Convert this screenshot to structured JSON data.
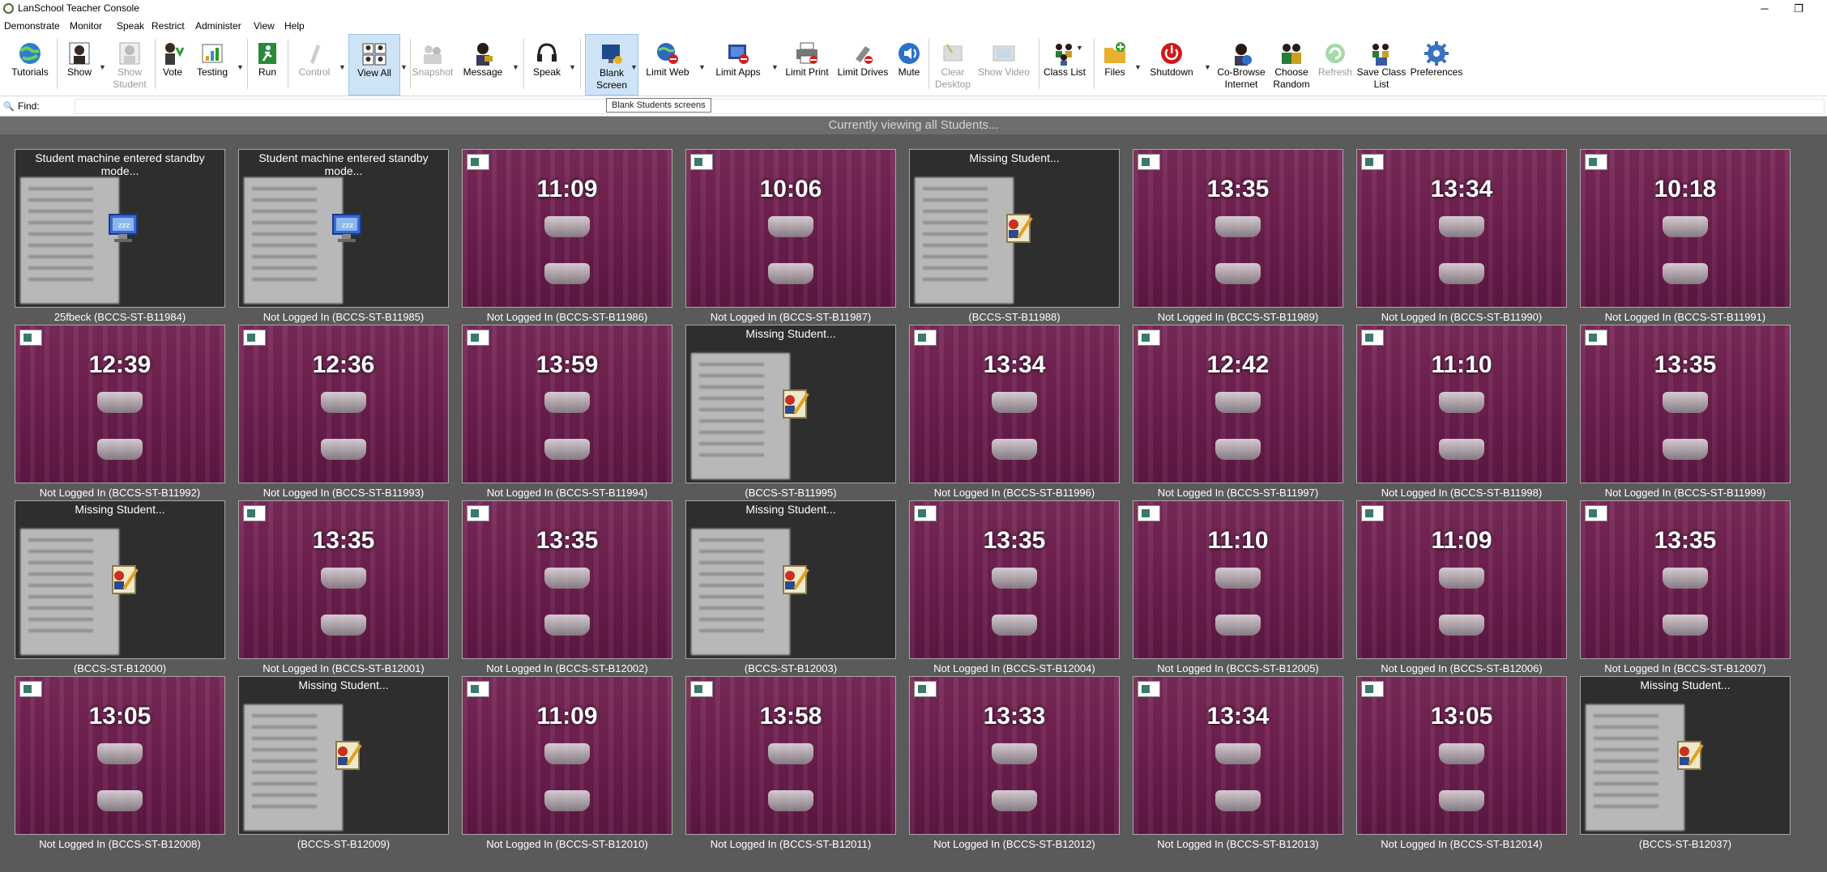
{
  "window": {
    "title": "LanSchool Teacher Console",
    "minimize": "─",
    "maximize": "❐"
  },
  "menu": [
    "Demonstrate",
    "Monitor",
    "Speak",
    "Restrict",
    "Administer",
    "View",
    "Help"
  ],
  "toolbar": {
    "tutorials": "Tutorials",
    "show": "Show",
    "show_student": "Show Student",
    "vote": "Vote",
    "testing": "Testing",
    "run": "Run",
    "control": "Control",
    "view_all": "View All",
    "snapshot": "Snapshot",
    "message": "Message",
    "speak": "Speak",
    "blank_screen": "Blank Screen",
    "limit_web": "Limit Web",
    "limit_apps": "Limit Apps",
    "limit_print": "Limit Print",
    "limit_drives": "Limit Drives",
    "mute": "Mute",
    "clear_desktop": "Clear Desktop",
    "show_video": "Show Video",
    "class_list": "Class List",
    "files": "Files",
    "shutdown": "Shutdown",
    "co_browse": "Co-Browse Internet",
    "choose_random": "Choose Random",
    "refresh": "Refresh",
    "save_class_list": "Save Class List",
    "preferences": "Preferences"
  },
  "find": {
    "label": "Find:",
    "value": ""
  },
  "tooltip": "Blank Students screens",
  "banner": "Currently viewing all Students...",
  "students": [
    {
      "caption": "25fbeck (BCCS-ST-B11984)",
      "state": "standby",
      "message": "Student machine entered standby mode...",
      "clock": ""
    },
    {
      "caption": "Not Logged In (BCCS-ST-B11985)",
      "state": "standby",
      "message": "Student machine entered standby mode...",
      "clock": ""
    },
    {
      "caption": "Not Logged In (BCCS-ST-B11986)",
      "state": "lock",
      "message": "",
      "clock": "11:09"
    },
    {
      "caption": "Not Logged In (BCCS-ST-B11987)",
      "state": "lock",
      "message": "",
      "clock": "10:06"
    },
    {
      "caption": "(BCCS-ST-B11988)",
      "state": "missing",
      "message": "Missing Student...",
      "clock": ""
    },
    {
      "caption": "Not Logged In (BCCS-ST-B11989)",
      "state": "lock",
      "message": "",
      "clock": "13:35"
    },
    {
      "caption": "Not Logged In (BCCS-ST-B11990)",
      "state": "lock",
      "message": "",
      "clock": "13:34"
    },
    {
      "caption": "Not Logged In (BCCS-ST-B11991)",
      "state": "lock",
      "message": "",
      "clock": "10:18"
    },
    {
      "caption": "Not Logged In (BCCS-ST-B11992)",
      "state": "lock",
      "message": "",
      "clock": "12:39"
    },
    {
      "caption": "Not Logged In (BCCS-ST-B11993)",
      "state": "lock",
      "message": "",
      "clock": "12:36"
    },
    {
      "caption": "Not Logged In (BCCS-ST-B11994)",
      "state": "lock",
      "message": "",
      "clock": "13:59"
    },
    {
      "caption": "(BCCS-ST-B11995)",
      "state": "missing",
      "message": "Missing Student...",
      "clock": ""
    },
    {
      "caption": "Not Logged In (BCCS-ST-B11996)",
      "state": "lock",
      "message": "",
      "clock": "13:34"
    },
    {
      "caption": "Not Logged In (BCCS-ST-B11997)",
      "state": "lock",
      "message": "",
      "clock": "12:42"
    },
    {
      "caption": "Not Logged In (BCCS-ST-B11998)",
      "state": "lock",
      "message": "",
      "clock": "11:10"
    },
    {
      "caption": "Not Logged In (BCCS-ST-B11999)",
      "state": "lock",
      "message": "",
      "clock": "13:35"
    },
    {
      "caption": "(BCCS-ST-B12000)",
      "state": "missing",
      "message": "Missing Student...",
      "clock": ""
    },
    {
      "caption": "Not Logged In (BCCS-ST-B12001)",
      "state": "lock",
      "message": "",
      "clock": "13:35"
    },
    {
      "caption": "Not Logged In (BCCS-ST-B12002)",
      "state": "lock",
      "message": "",
      "clock": "13:35"
    },
    {
      "caption": "(BCCS-ST-B12003)",
      "state": "missing",
      "message": "Missing Student...",
      "clock": ""
    },
    {
      "caption": "Not Logged In (BCCS-ST-B12004)",
      "state": "lock",
      "message": "",
      "clock": "13:35"
    },
    {
      "caption": "Not Logged In (BCCS-ST-B12005)",
      "state": "lock",
      "message": "",
      "clock": "11:10"
    },
    {
      "caption": "Not Logged In (BCCS-ST-B12006)",
      "state": "lock",
      "message": "",
      "clock": "11:09"
    },
    {
      "caption": "Not Logged In (BCCS-ST-B12007)",
      "state": "lock",
      "message": "",
      "clock": "13:35"
    },
    {
      "caption": "Not Logged In (BCCS-ST-B12008)",
      "state": "lock",
      "message": "",
      "clock": "13:05"
    },
    {
      "caption": "(BCCS-ST-B12009)",
      "state": "missing",
      "message": "Missing Student...",
      "clock": ""
    },
    {
      "caption": "Not Logged In (BCCS-ST-B12010)",
      "state": "lock",
      "message": "",
      "clock": "11:09"
    },
    {
      "caption": "Not Logged In (BCCS-ST-B12011)",
      "state": "lock",
      "message": "",
      "clock": "13:58"
    },
    {
      "caption": "Not Logged In (BCCS-ST-B12012)",
      "state": "lock",
      "message": "",
      "clock": "13:33"
    },
    {
      "caption": "Not Logged In (BCCS-ST-B12013)",
      "state": "lock",
      "message": "",
      "clock": "13:34"
    },
    {
      "caption": "Not Logged In (BCCS-ST-B12014)",
      "state": "lock",
      "message": "",
      "clock": "13:05"
    },
    {
      "caption": "(BCCS-ST-B12037)",
      "state": "missing",
      "message": "Missing Student...",
      "clock": ""
    }
  ]
}
